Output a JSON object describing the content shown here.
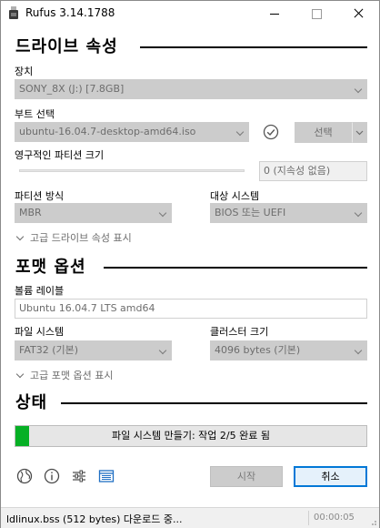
{
  "window": {
    "title": "Rufus 3.14.1788"
  },
  "drive_section": {
    "title": "드라이브 속성",
    "device_label": "장치",
    "device_value": "SONY_8X (J:) [7.8GB]",
    "boot_label": "부트 선택",
    "boot_value": "ubuntu-16.04.7-desktop-amd64.iso",
    "select_button": "선택",
    "persistent_label": "영구적인 파티션 크기",
    "persistent_value": "0 (지속성 없음)",
    "partition_label": "파티션 방식",
    "partition_value": "MBR",
    "target_label": "대상 시스템",
    "target_value": "BIOS 또는 UEFI",
    "advanced_toggle": "고급 드라이브 속성 표시"
  },
  "format_section": {
    "title": "포맷 옵션",
    "volume_label": "볼륨 레이블",
    "volume_value": "Ubuntu 16.04.7 LTS amd64",
    "filesystem_label": "파일 시스템",
    "filesystem_value": "FAT32 (기본)",
    "cluster_label": "클러스터 크기",
    "cluster_value": "4096 bytes (기본)",
    "advanced_toggle": "고급 포맷 옵션 표시"
  },
  "status_section": {
    "title": "상태",
    "progress_text": "파일 시스템 만들기: 작업 2/5 완료 됨",
    "progress_fraction": 0.04,
    "progress_color": "#06b025"
  },
  "toolbar": {
    "icons": [
      "globe-icon",
      "info-icon",
      "settings-sliders-icon",
      "log-icon"
    ],
    "start_button": "시작",
    "cancel_button": "취소"
  },
  "statusbar": {
    "text": "ldlinux.bss (512 bytes) 다운로드 중...",
    "time": "00:00:05"
  },
  "colors": {
    "accent": "#0078d7",
    "disabled_bg": "#cccccc"
  }
}
